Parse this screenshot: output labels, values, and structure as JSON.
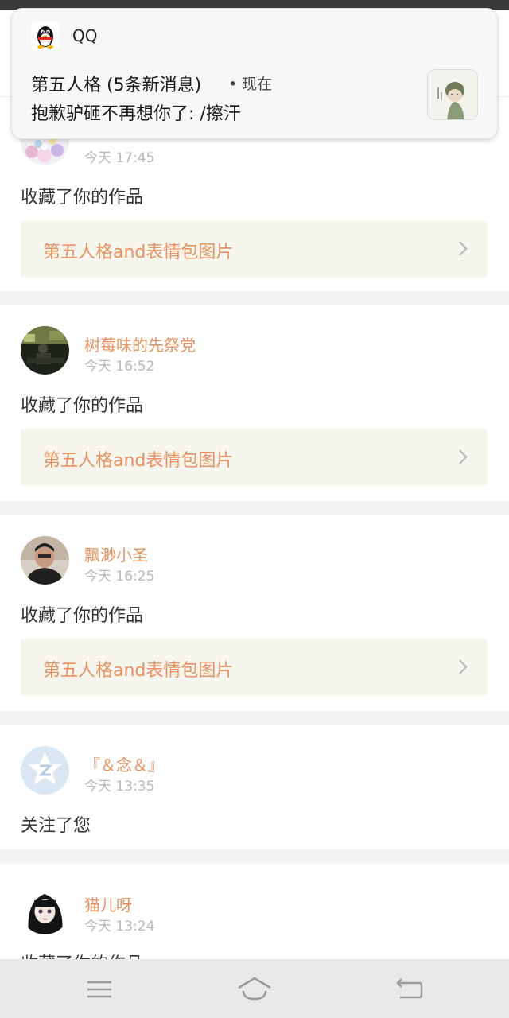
{
  "notification": {
    "app_name": "QQ",
    "title": "第五人格 (5条新消息)",
    "time": "• 现在",
    "body": "抱歉驴砸不再想你了: /擦汗",
    "app_icon": "qq-penguin-icon",
    "thumbnail": "sender-avatar"
  },
  "feed": [
    {
      "username": "",
      "time": "今天 17:45",
      "action": "收藏了你的作品",
      "work_title": "第五人格and表情包图片",
      "avatar": "avatar-flowers"
    },
    {
      "username": "树莓味的先祭党",
      "time": "今天 16:52",
      "action": "收藏了你的作品",
      "work_title": "第五人格and表情包图片",
      "avatar": "avatar-dark-photo"
    },
    {
      "username": "飘渺小圣",
      "time": "今天 16:25",
      "action": "收藏了你的作品",
      "work_title": "第五人格and表情包图片",
      "avatar": "avatar-man-portrait"
    },
    {
      "username": "『＆念＆』",
      "time": "今天 13:35",
      "action": "关注了您",
      "avatar": "avatar-default-z"
    },
    {
      "username": "猫儿呀",
      "time": "今天 13:24",
      "action": "收藏了你的作品",
      "avatar": "avatar-anime-girl"
    }
  ],
  "nav": {
    "menu_icon": "menu-icon",
    "home_icon": "home-icon",
    "back_icon": "back-icon"
  },
  "colors": {
    "accent": "#e6915f",
    "link_bg": "#f6f5ee",
    "time_text": "#b8b8b8",
    "nav_bg": "#e9e9e9"
  }
}
